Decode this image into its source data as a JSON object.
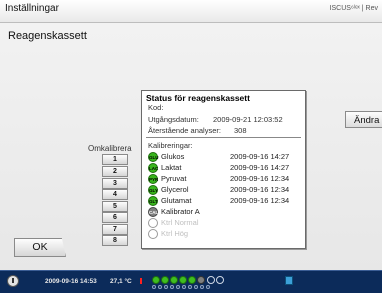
{
  "window": {
    "title": "Inställningar",
    "brand": "ISCUS⁶ˡᵉˣ | Rev"
  },
  "page": {
    "heading": "Reagenskassett"
  },
  "status": {
    "title": "Status för reagenskassett",
    "kod_label": "Kod:",
    "expiry_label": "Utgångsdatum:",
    "expiry_value": "2009-09-21 12:03:52",
    "remaining_label": "Återstående analyser:",
    "remaining_value": "308",
    "calibrations_heading": "Kalibreringar:",
    "calibrations": [
      {
        "code": "GLU",
        "name": "Glukos",
        "time": "2009-09-16 14:27",
        "state": "ok"
      },
      {
        "code": "LAC",
        "name": "Laktat",
        "time": "2009-09-16 14:27",
        "state": "ok"
      },
      {
        "code": "PYR",
        "name": "Pyruvat",
        "time": "2009-09-16 12:34",
        "state": "ok"
      },
      {
        "code": "GLY",
        "name": "Glycerol",
        "time": "2009-09-16 12:34",
        "state": "ok"
      },
      {
        "code": "GLT",
        "name": "Glutamat",
        "time": "2009-09-16 12:34",
        "state": "ok"
      },
      {
        "code": "CAL",
        "name": "Kalibrator A",
        "time": "",
        "state": "grey"
      },
      {
        "code": "",
        "name": "Ktrl Normal",
        "time": "",
        "state": "empty"
      },
      {
        "code": "",
        "name": "Ktrl Hög",
        "time": "",
        "state": "empty"
      }
    ]
  },
  "recalibrate": {
    "label": "Omkalibrera",
    "buttons": [
      "1",
      "2",
      "3",
      "4",
      "5",
      "6",
      "7",
      "8"
    ]
  },
  "buttons": {
    "change": "Ändra",
    "ok": "OK"
  },
  "statusbar": {
    "datetime": "2009-09-16 14:53",
    "temperature": "27,1 °C"
  },
  "colors": {
    "ok_green": "#39b51c",
    "status_bar": "#0c2b5a",
    "accent_red": "#ff2020"
  }
}
